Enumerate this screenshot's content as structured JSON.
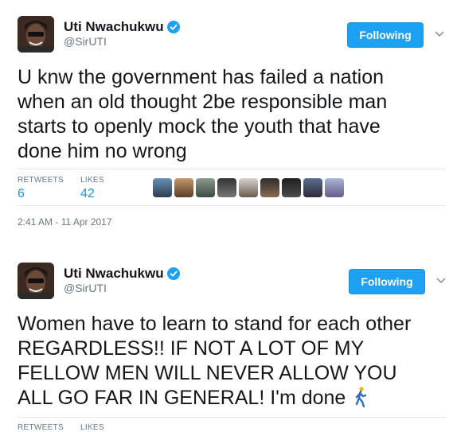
{
  "tweets": [
    {
      "name": "Uti Nwachukwu",
      "handle": "@SirUTI",
      "follow_label": "Following",
      "text_lines": [
        "U knw the government has failed a nation",
        "when an old thought 2be responsible man",
        "starts to openly mock the youth that have",
        "done him no wrong"
      ],
      "retweets_label": "RETWEETS",
      "retweets_count": "6",
      "likes_label": "LIKES",
      "likes_count": "42",
      "timestamp": "2:41 AM - 11 Apr 2017"
    },
    {
      "name": "Uti Nwachukwu",
      "handle": "@SirUTI",
      "follow_label": "Following",
      "text_lines": [
        "Women have to learn to stand for each other",
        "REGARDLESS!! IF NOT A LOT OF MY",
        "FELLOW MEN WILL NEVER ALLOW YOU",
        "ALL GO FAR IN GENERAL! I'm done"
      ],
      "text_emoji": "person-walking-icon",
      "retweets_label": "RETWEETS",
      "likes_label": "LIKES"
    }
  ],
  "colors": {
    "follow_button": "#1da1f2",
    "stat_value": "#1b95e0",
    "verified": "#1da1f2",
    "muted": "#657786"
  },
  "icons": {
    "verified": "verified-badge-icon",
    "chevron": "chevron-down-icon"
  }
}
